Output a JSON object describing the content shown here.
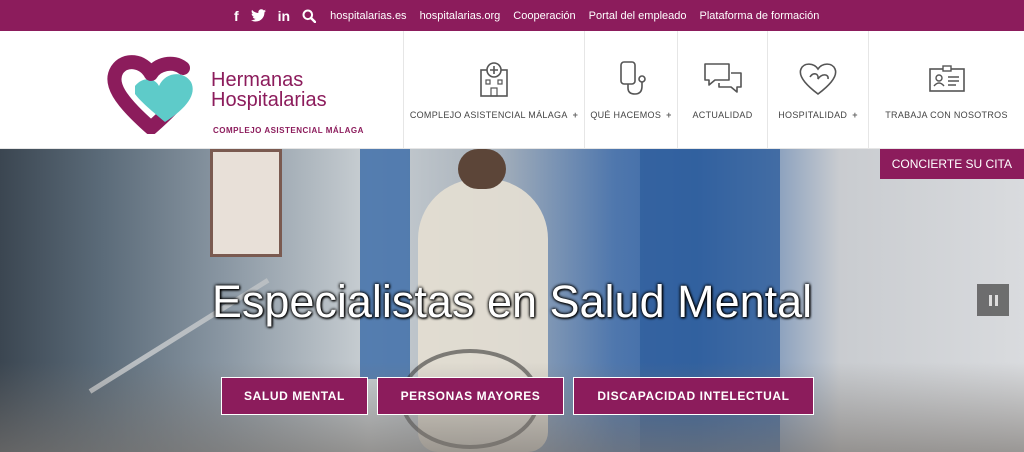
{
  "topbar": {
    "social": [
      {
        "icon": "facebook-icon",
        "glyph": "f"
      },
      {
        "icon": "twitter-icon",
        "glyph": "t"
      },
      {
        "icon": "linkedin-icon",
        "glyph": "in"
      },
      {
        "icon": "search-icon",
        "glyph": ""
      }
    ],
    "links": [
      "hospitalarias.es",
      "hospitalarias.org",
      "Cooperación",
      "Portal del empleado",
      "Plataforma de formación"
    ]
  },
  "logo": {
    "name_line1": "Hermanas",
    "name_line2": "Hospitalarias",
    "subtitle": "COMPLEJO ASISTENCIAL MÁLAGA"
  },
  "nav": [
    {
      "label": "COMPLEJO ASISTENCIAL MÁLAGA",
      "plus": "+",
      "icon": "hospital-icon"
    },
    {
      "label": "QUÉ HACEMOS",
      "plus": "+",
      "icon": "phone-stethoscope-icon"
    },
    {
      "label": "ACTUALIDAD",
      "plus": "",
      "icon": "chat-bubbles-icon"
    },
    {
      "label": "HOSPITALIDAD",
      "plus": "+",
      "icon": "heart-icon"
    },
    {
      "label": "TRABAJA CON NOSOTROS",
      "plus": "",
      "icon": "id-card-icon"
    }
  ],
  "hero": {
    "cta": "CONCIERTE SU CITA",
    "headline": "Especialistas en Salud Mental",
    "buttons": [
      "SALUD MENTAL",
      "PERSONAS MAYORES",
      "DISCAPACIDAD INTELECTUAL"
    ]
  },
  "colors": {
    "brand": "#8c1c5c",
    "accent": "#5ecbc9"
  }
}
